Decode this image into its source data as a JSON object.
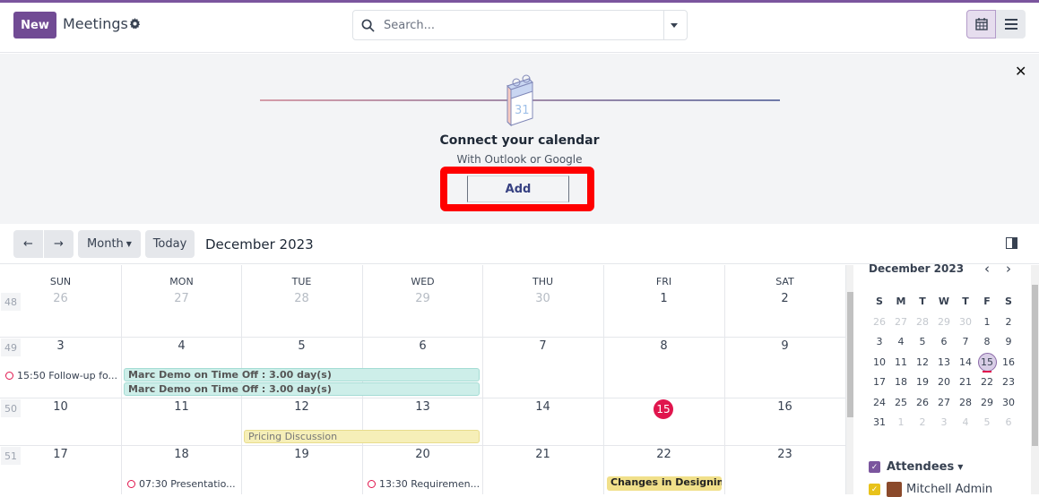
{
  "app": {
    "title": "Meetings",
    "new_label": "New",
    "brand_color": "#714b94"
  },
  "search": {
    "placeholder": "Search..."
  },
  "views": [
    {
      "name": "calendar",
      "active": true
    },
    {
      "name": "list",
      "active": false
    }
  ],
  "banner": {
    "heading": "Connect your calendar",
    "subheading": "With Outlook or Google",
    "add_label": "Add",
    "illustration_day": "31"
  },
  "toolbar": {
    "prev": "←",
    "next": "→",
    "scale_label": "Month",
    "today_label": "Today",
    "range_label": "December 2023"
  },
  "calendar": {
    "weekdays": [
      "SUN",
      "MON",
      "TUE",
      "WED",
      "THU",
      "FRI",
      "SAT"
    ],
    "weeks": [
      {
        "num": "48",
        "days": [
          {
            "d": "26",
            "m": true
          },
          {
            "d": "27",
            "m": true
          },
          {
            "d": "28",
            "m": true
          },
          {
            "d": "29",
            "m": true
          },
          {
            "d": "30",
            "m": true
          },
          {
            "d": "1"
          },
          {
            "d": "2"
          }
        ]
      },
      {
        "num": "49",
        "days": [
          {
            "d": "3"
          },
          {
            "d": "4"
          },
          {
            "d": "5"
          },
          {
            "d": "6"
          },
          {
            "d": "7"
          },
          {
            "d": "8"
          },
          {
            "d": "9"
          }
        ]
      },
      {
        "num": "50",
        "days": [
          {
            "d": "10"
          },
          {
            "d": "11"
          },
          {
            "d": "12"
          },
          {
            "d": "13"
          },
          {
            "d": "14"
          },
          {
            "d": "15",
            "today": true
          },
          {
            "d": "16"
          }
        ]
      },
      {
        "num": "51",
        "days": [
          {
            "d": "17"
          },
          {
            "d": "18"
          },
          {
            "d": "19"
          },
          {
            "d": "20"
          },
          {
            "d": "21"
          },
          {
            "d": "22"
          },
          {
            "d": "23"
          }
        ]
      }
    ],
    "events": {
      "followup": "15:50 Follow-up fo...",
      "timeoff1": "Marc Demo on Time Off : 3.00 day(s)",
      "timeoff2": "Marc Demo on Time Off : 3.00 day(s)",
      "pricing": "Pricing Discussion",
      "presentation": "07:30 Presentatio...",
      "requirement": "13:30 Requiremen...",
      "designing": "Changes in Designing"
    }
  },
  "sidebar": {
    "month_label": "December 2023",
    "weekdays": [
      "S",
      "M",
      "T",
      "W",
      "T",
      "F",
      "S"
    ],
    "weeks": [
      [
        {
          "d": "26",
          "m": true
        },
        {
          "d": "27",
          "m": true
        },
        {
          "d": "28",
          "m": true
        },
        {
          "d": "29",
          "m": true
        },
        {
          "d": "30",
          "m": true
        },
        {
          "d": "1"
        },
        {
          "d": "2"
        }
      ],
      [
        {
          "d": "3"
        },
        {
          "d": "4"
        },
        {
          "d": "5"
        },
        {
          "d": "6"
        },
        {
          "d": "7"
        },
        {
          "d": "8"
        },
        {
          "d": "9"
        }
      ],
      [
        {
          "d": "10"
        },
        {
          "d": "11"
        },
        {
          "d": "12"
        },
        {
          "d": "13"
        },
        {
          "d": "14"
        },
        {
          "d": "15",
          "sel": true
        },
        {
          "d": "16"
        }
      ],
      [
        {
          "d": "17"
        },
        {
          "d": "18"
        },
        {
          "d": "19"
        },
        {
          "d": "20"
        },
        {
          "d": "21"
        },
        {
          "d": "22"
        },
        {
          "d": "23"
        }
      ],
      [
        {
          "d": "24"
        },
        {
          "d": "25"
        },
        {
          "d": "26"
        },
        {
          "d": "27"
        },
        {
          "d": "28"
        },
        {
          "d": "29"
        },
        {
          "d": "30"
        }
      ],
      [
        {
          "d": "31"
        },
        {
          "d": "1",
          "m": true
        },
        {
          "d": "2",
          "m": true
        },
        {
          "d": "3",
          "m": true
        },
        {
          "d": "4",
          "m": true
        },
        {
          "d": "5",
          "m": true
        },
        {
          "d": "6",
          "m": true
        }
      ]
    ],
    "filter_label": "Attendees",
    "attendee": "Mitchell Admin",
    "colors": {
      "attendees_check": "#7b559e",
      "user_check": "#e8c21a",
      "today": "#e0154d"
    }
  }
}
